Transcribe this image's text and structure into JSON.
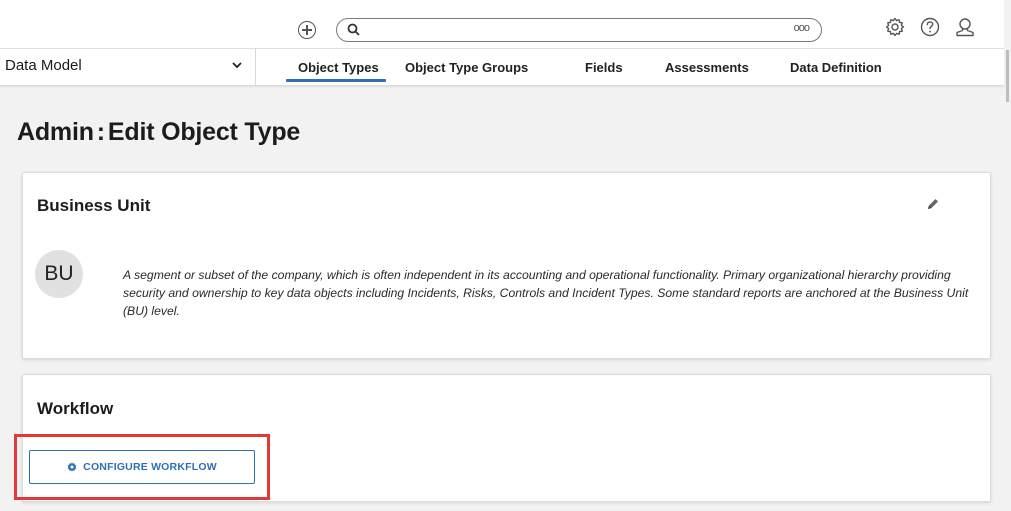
{
  "topbar": {
    "search_placeholder": "",
    "more_glyph": "ooo",
    "icons": [
      "add-icon",
      "search-icon",
      "more-icon",
      "settings-icon",
      "help-icon",
      "user-icon"
    ]
  },
  "navbar": {
    "module_label": "Data Model",
    "tabs": [
      {
        "label": "Object Types",
        "active": true
      },
      {
        "label": "Object Type Groups",
        "active": false
      },
      {
        "label": "Fields",
        "active": false
      },
      {
        "label": "Assessments",
        "active": false
      },
      {
        "label": "Data Definition",
        "active": false
      }
    ]
  },
  "page": {
    "title_prefix": "Admin",
    "title_separator": ":",
    "title_suffix": "Edit Object Type"
  },
  "object_card": {
    "name": "Business Unit",
    "avatar_initials": "BU",
    "description": "A segment or subset of the company, which is often independent in its accounting and operational functionality. Primary organizational hierarchy providing security and ownership to key data objects including Incidents, Risks, Controls and Incident Types. Some standard reports are anchored at the Business Unit (BU) level."
  },
  "workflow_card": {
    "title": "Workflow",
    "configure_button": "CONFIGURE WORKFLOW"
  },
  "colors": {
    "accent": "#2f6fb5",
    "highlight": "#e03a3a",
    "background": "#f2f2f2"
  }
}
